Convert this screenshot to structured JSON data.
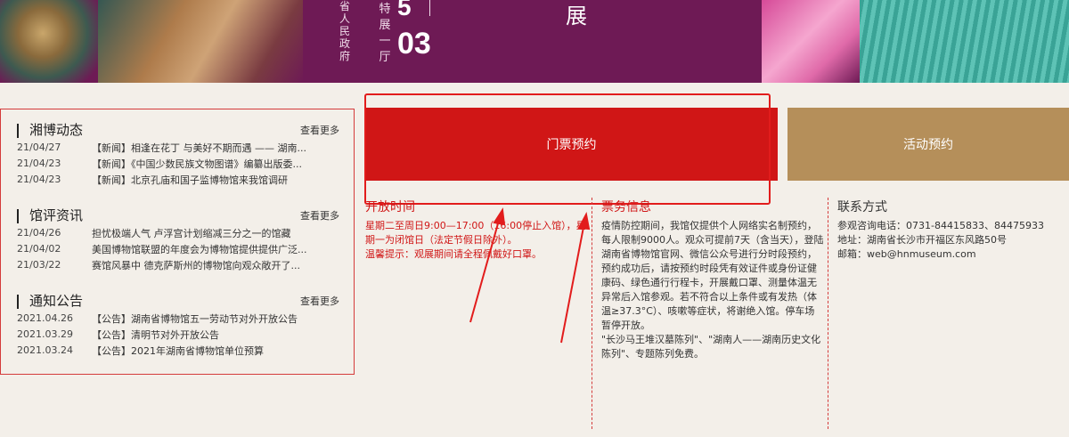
{
  "banner": {
    "vertical_text": "省人民政府",
    "vertical_text2": "特展一厅",
    "month": "5",
    "day": "03",
    "title": "展"
  },
  "news": {
    "sections": [
      {
        "title": "湘博动态",
        "more": "查看更多",
        "items": [
          {
            "date": "21/04/27",
            "text": "【新闻】相逢在花丁 与美好不期而遇 —— 湖南..."
          },
          {
            "date": "21/04/23",
            "text": "【新闻】《中国少数民族文物图谱》编纂出版委..."
          },
          {
            "date": "21/04/23",
            "text": "【新闻】北京孔庙和国子监博物馆来我馆调研"
          }
        ]
      },
      {
        "title": "馆评资讯",
        "more": "查看更多",
        "items": [
          {
            "date": "21/04/26",
            "text": "担忧极端人气 卢浮宫计划缩减三分之一的馆藏"
          },
          {
            "date": "21/04/02",
            "text": "美国博物馆联盟的年度会为博物馆提供提供广泛..."
          },
          {
            "date": "21/03/22",
            "text": "赛馆风暴中 德克萨斯州的博物馆向观众敞开了..."
          }
        ]
      },
      {
        "title": "通知公告",
        "more": "查看更多",
        "items": [
          {
            "date": "2021.04.26",
            "text": "【公告】湖南省博物馆五一劳动节对外开放公告"
          },
          {
            "date": "2021.03.29",
            "text": "【公告】清明节对外开放公告"
          },
          {
            "date": "2021.03.24",
            "text": "【公告】2021年湖南省博物馆单位预算"
          }
        ]
      }
    ]
  },
  "buttons": {
    "ticket": "门票预约",
    "activity": "活动预约"
  },
  "opening": {
    "title": "开放时间",
    "lines": [
      "星期二至周日9:00—17:00（16:00停止入馆），星期一为闭馆日（法定节假日除外）。",
      "温馨提示：观展期间请全程佩戴好口罩。"
    ]
  },
  "service": {
    "title": "票务信息",
    "text": "疫情防控期间，我馆仅提供个人网络实名制预约，每人限制9000人。观众可提前7天（含当天），登陆湖南省博物馆官网、微信公众号进行分时段预约，预约成功后，请按预约时段凭有效证件或身份证健康码、绿色通行行程卡，开展戴口罩、测量体温无异常后入馆参观。若不符合以上条件或有发热（体温≥37.3°C）、咳嗽等症状，将谢绝入馆。停车场暂停开放。",
    "note": "\"长沙马王堆汉墓陈列\"、\"湖南人——湖南历史文化陈列\"、专题陈列免费。"
  },
  "contact": {
    "title": "联系方式",
    "phone_label": "参观咨询电话：",
    "phone": "0731-84415833、84475933",
    "address_label": "地址：",
    "address": "湖南省长沙市开福区东风路50号",
    "email_label": "邮箱：",
    "email": "web@hnmuseum.com"
  },
  "colors": {
    "accent_red": "#d01616",
    "gold": "#b58f5a",
    "banner_purple": "#6e1a55"
  }
}
